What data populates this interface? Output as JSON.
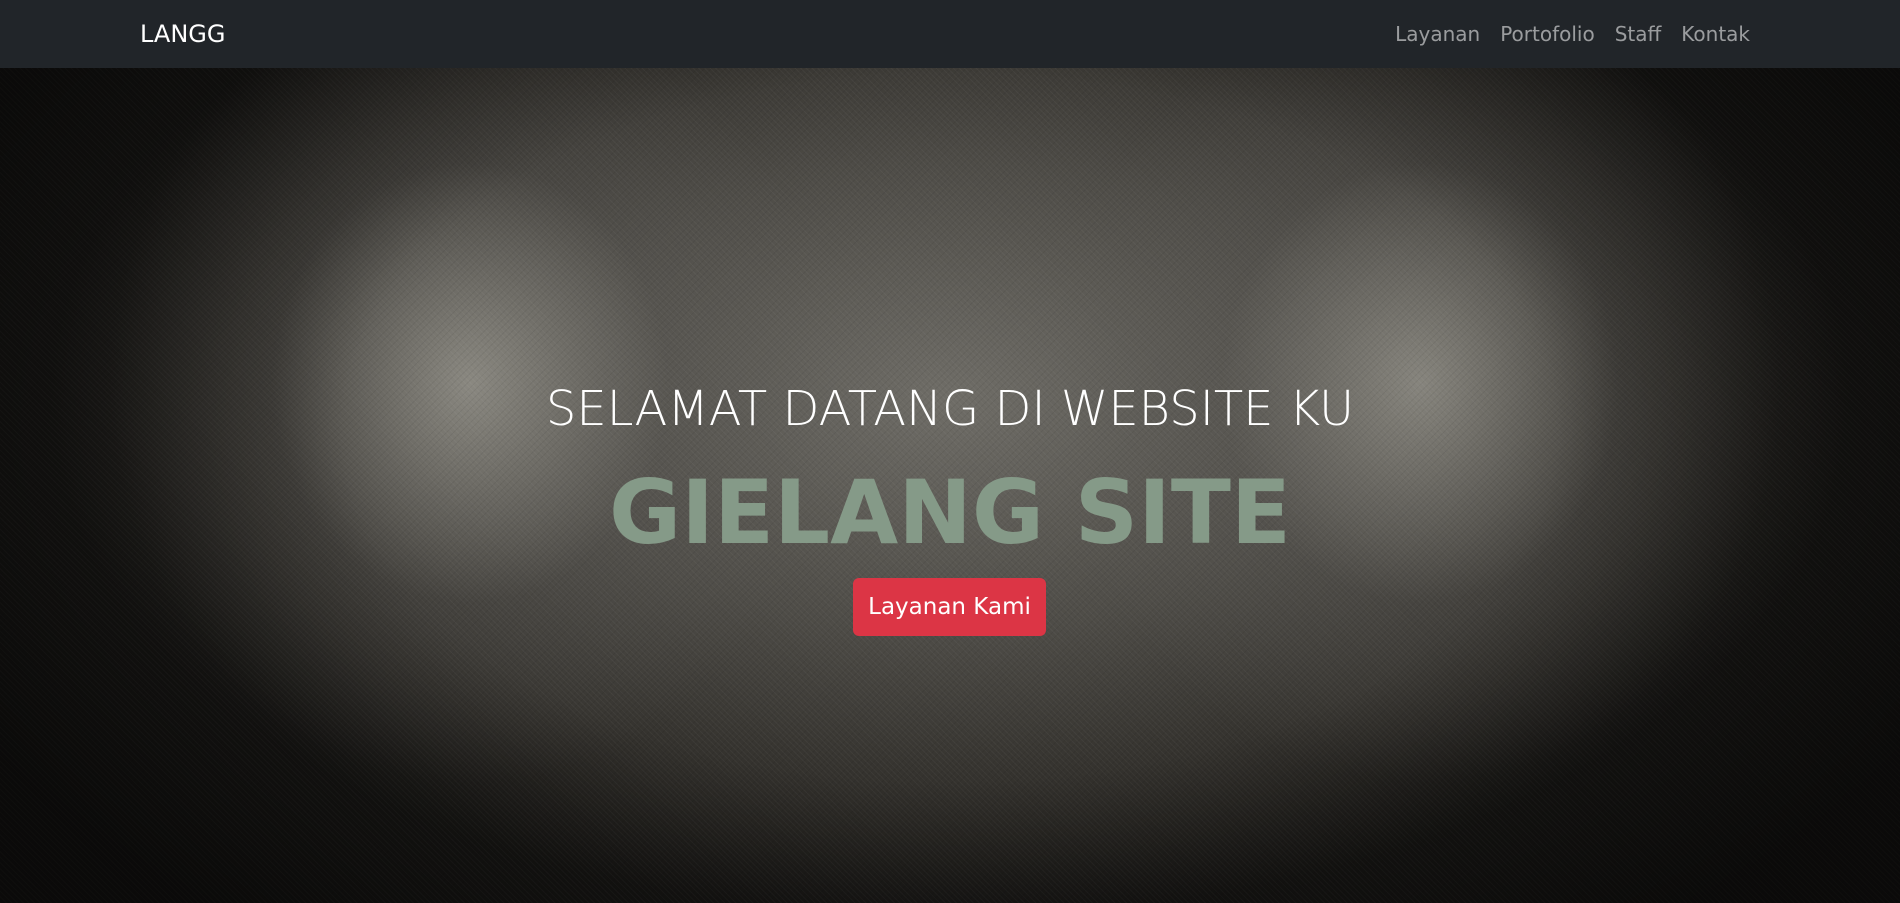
{
  "navbar": {
    "brand": "LANGG",
    "links": [
      {
        "label": "Layanan"
      },
      {
        "label": "Portofolio"
      },
      {
        "label": "Staff"
      },
      {
        "label": "Kontak"
      }
    ]
  },
  "hero": {
    "subtitle": "SELAMAT DATANG DI WEBSITE KU",
    "title": "GIELANG SITE",
    "button_label": "Layanan Kami"
  },
  "colors": {
    "navbar_bg": "#212529",
    "title_color": "#859a88",
    "button_bg": "#dc3545",
    "nav_link": "rgba(255,255,255,0.55)"
  }
}
